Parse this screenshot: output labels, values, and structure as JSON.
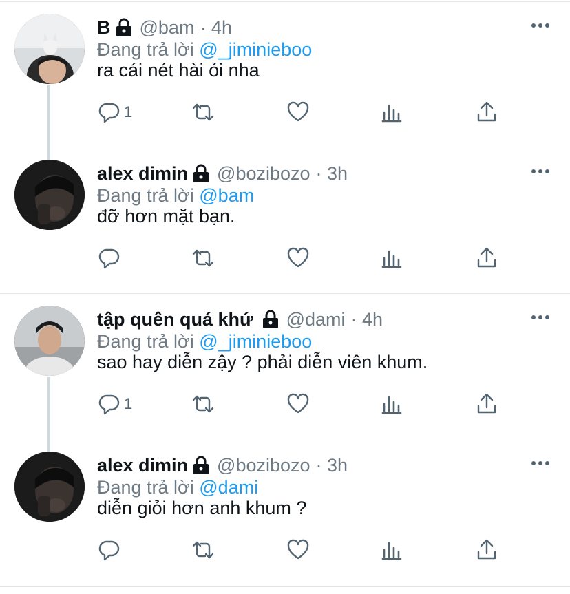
{
  "tweets": [
    {
      "name": "B",
      "handle": "@bam",
      "time": "· 4h",
      "reply_prefix": "Đang trả lời ",
      "reply_to": "@_jiminieboo",
      "text": "ra cái nét hài ói nha",
      "reply_count": "1"
    },
    {
      "name": "alex dimin",
      "handle": "@bozibozo",
      "time": "· 3h",
      "reply_prefix": "Đang trả lời ",
      "reply_to": "@bam",
      "text": "đỡ hơn mặt bạn.",
      "reply_count": ""
    },
    {
      "name": "tập quên quá khứ",
      "handle": "@dami",
      "time": "· 4h",
      "reply_prefix": "Đang trả lời ",
      "reply_to": "@_jiminieboo",
      "text": "sao hay diễn zậy ? phải diễn viên khum.",
      "reply_count": "1"
    },
    {
      "name": "alex dimin",
      "handle": "@bozibozo",
      "time": "· 3h",
      "reply_prefix": "Đang trả lời ",
      "reply_to": "@dami",
      "text": "diễn giỏi hơn anh khum ?",
      "reply_count": ""
    }
  ],
  "icons": {
    "lock": "lock-icon",
    "more": "more-icon",
    "reply": "reply-icon",
    "retweet": "retweet-icon",
    "like": "heart-icon",
    "stats": "stats-icon",
    "share": "share-icon"
  },
  "colors": {
    "text": "#0f1419",
    "secondary": "#6e7a83",
    "link": "#1d9bf0",
    "icon": "#536471",
    "thread_line": "#cfd9de",
    "divider": "#e1e6ea"
  }
}
